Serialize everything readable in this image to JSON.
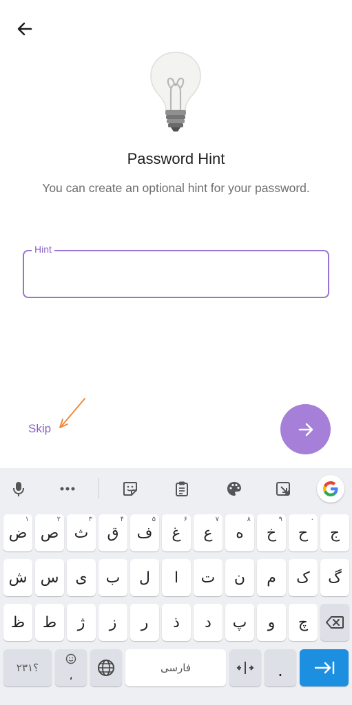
{
  "header": {
    "back_icon": "arrow-left-icon"
  },
  "illustration": {
    "icon": "light-bulb-icon"
  },
  "title": "Password Hint",
  "subtitle": "You can create an optional hint for your password.",
  "hint_field": {
    "label": "Hint",
    "value": "",
    "placeholder": ""
  },
  "skip_label": "Skip",
  "next_icon": "arrow-right-icon",
  "colors": {
    "accent": "#a57fd8",
    "label": "#8b63c8",
    "border": "#9a72d0",
    "enter": "#1d8fe1"
  },
  "keyboard": {
    "toolbar": [
      "mic-icon",
      "more-icon",
      "sticker-icon",
      "clipboard-icon",
      "palette-icon",
      "resize-icon",
      "google-icon"
    ],
    "row1": [
      {
        "c": "ض",
        "s": "۱"
      },
      {
        "c": "ص",
        "s": "۲"
      },
      {
        "c": "ث",
        "s": "۳"
      },
      {
        "c": "ق",
        "s": "۴"
      },
      {
        "c": "ف",
        "s": "۵"
      },
      {
        "c": "غ",
        "s": "۶"
      },
      {
        "c": "ع",
        "s": "۷"
      },
      {
        "c": "ه",
        "s": "۸"
      },
      {
        "c": "خ",
        "s": "۹"
      },
      {
        "c": "ح",
        "s": "۰"
      },
      {
        "c": "ج",
        "s": ""
      }
    ],
    "row2": [
      "ش",
      "س",
      "ی",
      "ب",
      "ل",
      "ا",
      "ت",
      "ن",
      "م",
      "ک",
      "گ"
    ],
    "row3": [
      "ظ",
      "ط",
      "ژ",
      "ز",
      "ر",
      "ذ",
      "د",
      "پ",
      "و",
      "چ"
    ],
    "symbols_label": "؟۲۳۱",
    "emoji_comma": "،",
    "space_label": "فارسی",
    "period": ".",
    "enter_icon": "tab-enter-icon"
  }
}
